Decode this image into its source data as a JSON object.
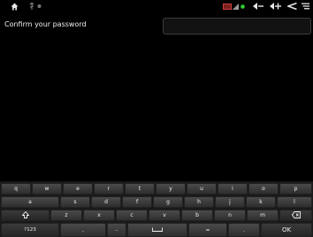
{
  "screen": {
    "prompt": "Confirm your password"
  },
  "password_field": {
    "value": ""
  },
  "status_bar": {
    "left_icons": [
      "home-icon",
      "usb-icon",
      "debug-icon"
    ],
    "right_icons": [
      "battery-icon",
      "signal-icon",
      "status-dot-icon",
      "volume-down-icon",
      "volume-up-icon",
      "back-icon",
      "menu-icon"
    ]
  },
  "keyboard": {
    "row1": [
      "q",
      "w",
      "e",
      "r",
      "t",
      "y",
      "u",
      "i",
      "o",
      "p"
    ],
    "row2": [
      "a",
      "s",
      "d",
      "f",
      "g",
      "h",
      "j",
      "k",
      "l"
    ],
    "row3": [
      "z",
      "x",
      "c",
      "v",
      "b",
      "n",
      "m"
    ],
    "row4": {
      "mode_label": "?123",
      "comma": ",",
      "dash": "-",
      "equals": "=",
      "period": ".",
      "ok_label": "OK"
    }
  },
  "colors": {
    "background": "#000000",
    "key": "#3c3c3c",
    "status_dot": "#2fd12f",
    "battery": "#c94040"
  }
}
